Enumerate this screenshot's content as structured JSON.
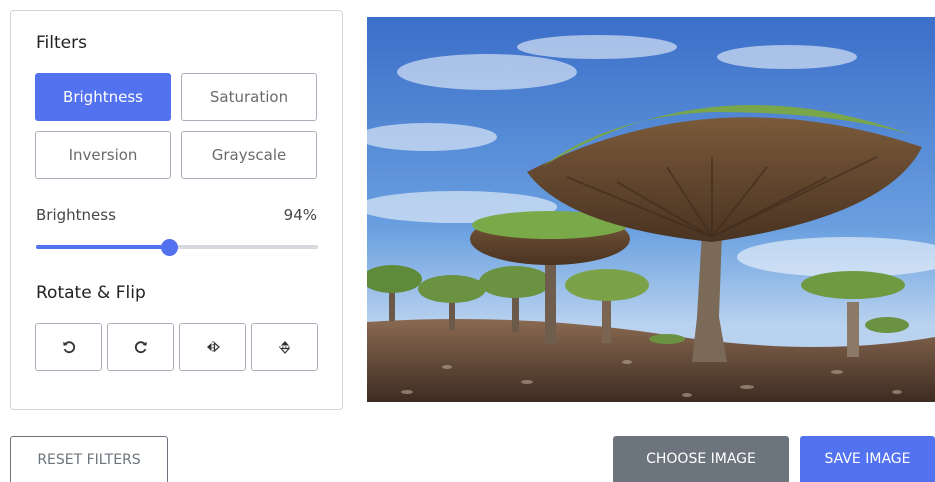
{
  "filters": {
    "title": "Filters",
    "buttons": [
      {
        "label": "Brightness",
        "active": true
      },
      {
        "label": "Saturation",
        "active": false
      },
      {
        "label": "Inversion",
        "active": false
      },
      {
        "label": "Grayscale",
        "active": false
      }
    ]
  },
  "slider": {
    "label": "Brightness",
    "value_text": "94%",
    "fraction": 0.47
  },
  "rotate_flip": {
    "title": "Rotate & Flip",
    "icons": [
      "rotate-left-icon",
      "rotate-right-icon",
      "flip-horizontal-icon",
      "flip-vertical-icon"
    ]
  },
  "actions": {
    "reset_label": "RESET FILTERS",
    "choose_label": "CHOOSE IMAGE",
    "save_label": "SAVE IMAGE"
  },
  "colors": {
    "accent": "#5372f0",
    "secondary": "#6c757d"
  }
}
